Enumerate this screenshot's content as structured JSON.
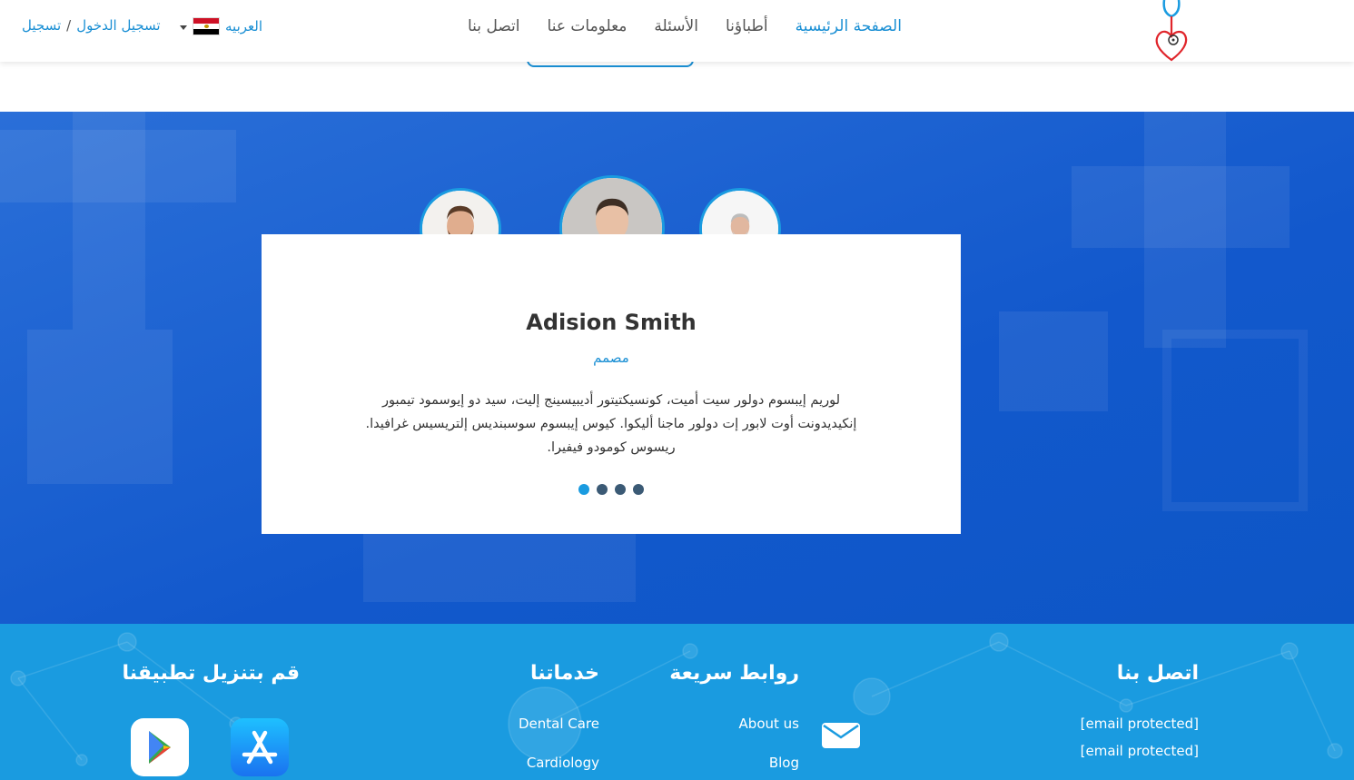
{
  "header": {
    "auth": {
      "login": "تسجيل الدخول",
      "separator": "/",
      "register": "تسجيل"
    },
    "language": {
      "label": "العربيه"
    },
    "nav": [
      {
        "label": "اتصل بنا"
      },
      {
        "label": "معلومات عنا"
      },
      {
        "label": "الأسئلة"
      },
      {
        "label": "أطباؤنا"
      },
      {
        "label": "الصفحة الرئيسية"
      }
    ]
  },
  "testimonial": {
    "name": "Adision Smith",
    "role": "مصمم",
    "text": "لوريم إيبسوم دولور سيت أميت، كونسيكتيتور أديبيسينج إليت، سيد دو إيوسمود تيمبور إنكيديدونت أوت لابور إت دولور ماجنا أليكوا. كيوس إيبسوم سوسبنديس إلتريسيس غرافيدا. ريسوس كومودو فيفيرا.",
    "slide_count": 4,
    "active_slide": 1
  },
  "footer": {
    "app": {
      "title": "قم بتنزيل تطبيقنا"
    },
    "services": {
      "title": "خدماتنا",
      "items": [
        "Dental Care",
        "Cardiology"
      ]
    },
    "quick_links": {
      "title": "روابط سريعة",
      "items": [
        "About us",
        "Blog"
      ]
    },
    "contact": {
      "title": "اتصل بنا",
      "emails": [
        "[email protected]",
        "[email protected]"
      ]
    }
  },
  "colors": {
    "primary": "#1a8fd4",
    "testimonial_bg": "#1258cc",
    "footer_bg": "#1a9be0"
  }
}
